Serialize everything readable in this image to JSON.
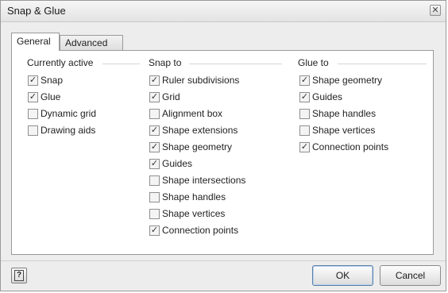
{
  "window": {
    "title": "Snap & Glue",
    "close_glyph": "✕"
  },
  "tabs": [
    {
      "label": "General",
      "active": true
    },
    {
      "label": "Advanced",
      "active": false
    }
  ],
  "groups": {
    "currently_active": {
      "header": "Currently active",
      "items": [
        {
          "label": "Snap",
          "checked": true
        },
        {
          "label": "Glue",
          "checked": true
        },
        {
          "label": "Dynamic grid",
          "checked": false
        },
        {
          "label": "Drawing aids",
          "checked": false
        }
      ]
    },
    "snap_to": {
      "header": "Snap to",
      "items": [
        {
          "label": "Ruler subdivisions",
          "checked": true
        },
        {
          "label": "Grid",
          "checked": true
        },
        {
          "label": "Alignment box",
          "checked": false
        },
        {
          "label": "Shape extensions",
          "checked": true
        },
        {
          "label": "Shape geometry",
          "checked": true
        },
        {
          "label": "Guides",
          "checked": true
        },
        {
          "label": "Shape intersections",
          "checked": false
        },
        {
          "label": "Shape handles",
          "checked": false
        },
        {
          "label": "Shape vertices",
          "checked": false
        },
        {
          "label": "Connection points",
          "checked": true
        }
      ]
    },
    "glue_to": {
      "header": "Glue to",
      "items": [
        {
          "label": "Shape geometry",
          "checked": true
        },
        {
          "label": "Guides",
          "checked": true
        },
        {
          "label": "Shape handles",
          "checked": false
        },
        {
          "label": "Shape vertices",
          "checked": false
        },
        {
          "label": "Connection points",
          "checked": true
        }
      ]
    }
  },
  "footer": {
    "help_glyph": "?",
    "ok_label": "OK",
    "cancel_label": "Cancel"
  },
  "check_glyph": "✓",
  "icons": {
    "help": "help-icon",
    "close": "close-icon",
    "check": "checkmark-icon"
  }
}
